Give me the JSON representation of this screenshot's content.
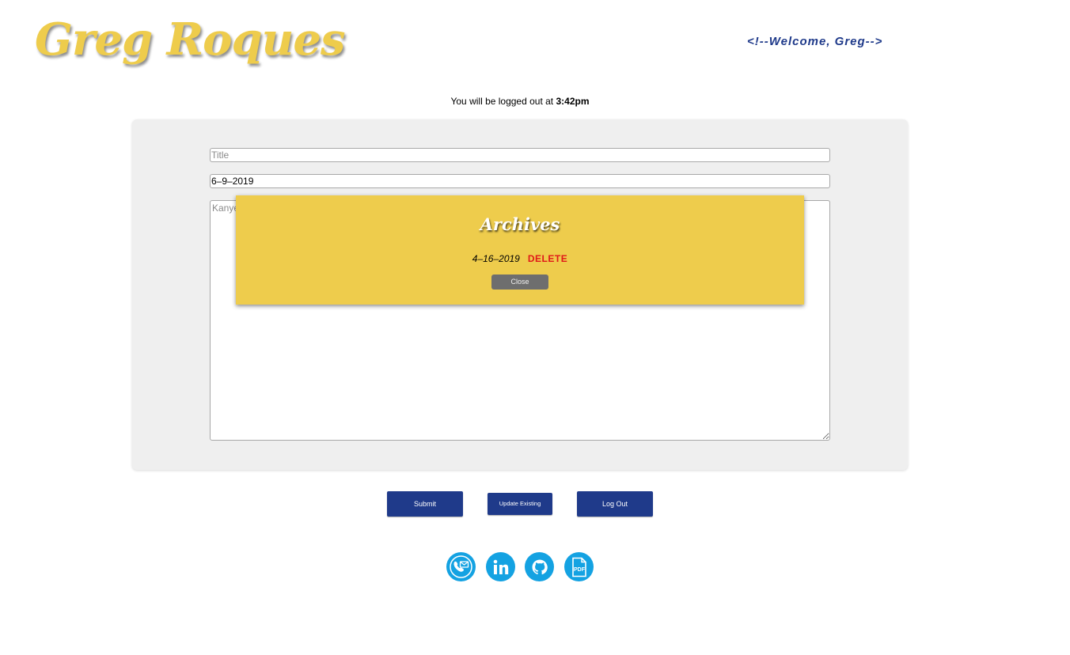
{
  "header": {
    "logo_text": "Greg Roques",
    "welcome_text": "<!--Welcome, Greg-->"
  },
  "session": {
    "logout_prefix": "You will be logged out at ",
    "logout_time": "3:42pm"
  },
  "form": {
    "title_placeholder": "Title",
    "title_value": "",
    "date_value": "6–9–2019",
    "body_placeholder": "Kanye"
  },
  "archives_modal": {
    "title": "Archives",
    "entries": [
      {
        "date": "4–16–2019",
        "delete_label": "DELETE"
      }
    ],
    "close_label": "Close"
  },
  "actions": {
    "submit_label": "Submit",
    "update_label": "Update Existing",
    "logout_label": "Log Out"
  },
  "social": [
    {
      "name": "contact",
      "icon": "phone-mail-icon"
    },
    {
      "name": "linkedin",
      "icon": "linkedin-icon"
    },
    {
      "name": "github",
      "icon": "github-icon"
    },
    {
      "name": "resume",
      "icon": "pdf-icon"
    }
  ],
  "colors": {
    "brand_yellow": "#eecc4c",
    "navy": "#1f3a8a",
    "delete_red": "#e01818",
    "social_blue": "#14a2e2",
    "panel_gray": "#efefef",
    "close_gray": "#6e6e6e"
  }
}
